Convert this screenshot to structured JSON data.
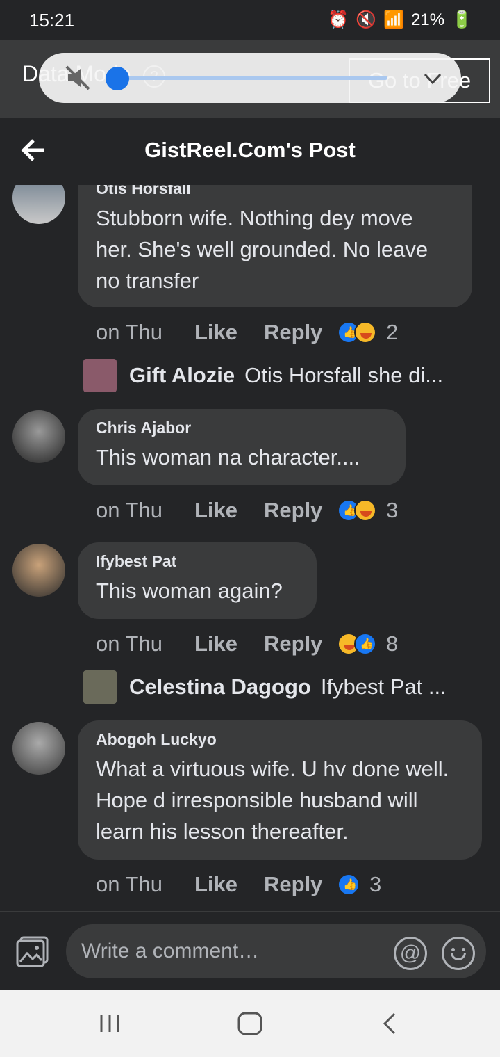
{
  "status_bar": {
    "time": "15:21",
    "battery": "21%"
  },
  "data_mode_bar": {
    "label": "Data Mode",
    "help": "?",
    "goto_label": "Go to Free"
  },
  "header": {
    "title": "GistReel.Com's Post"
  },
  "comments": [
    {
      "name": "Otis Horsfall",
      "text": "Stubborn wife. Nothing dey move her. She's well grounded. No leave no transfer",
      "time": "on Thu",
      "like": "Like",
      "reply": "Reply",
      "reaction_count": "2",
      "reply_preview": {
        "name": "Gift Alozie",
        "text": "Otis Horsfall she di..."
      }
    },
    {
      "name": "Chris Ajabor",
      "text": "This woman na character....",
      "time": "on Thu",
      "like": "Like",
      "reply": "Reply",
      "reaction_count": "3"
    },
    {
      "name": "Ifybest Pat",
      "text": "This woman again?",
      "time": "on Thu",
      "like": "Like",
      "reply": "Reply",
      "reaction_count": "8",
      "reply_preview": {
        "name": "Celestina Dagogo",
        "text": "Ifybest Pat ..."
      }
    },
    {
      "name": "Abogoh Luckyo",
      "text": "What a virtuous wife. U hv done well. Hope d irresponsible husband will learn his lesson thereafter.",
      "time": "on Thu",
      "like": "Like",
      "reply": "Reply",
      "reaction_count": "3"
    }
  ],
  "composer": {
    "placeholder": "Write a comment…",
    "at": "@"
  },
  "colors": {
    "background": "#242527",
    "bubble": "#3a3b3c",
    "like_blue": "#1877f2",
    "haha_yellow": "#f7b928"
  }
}
